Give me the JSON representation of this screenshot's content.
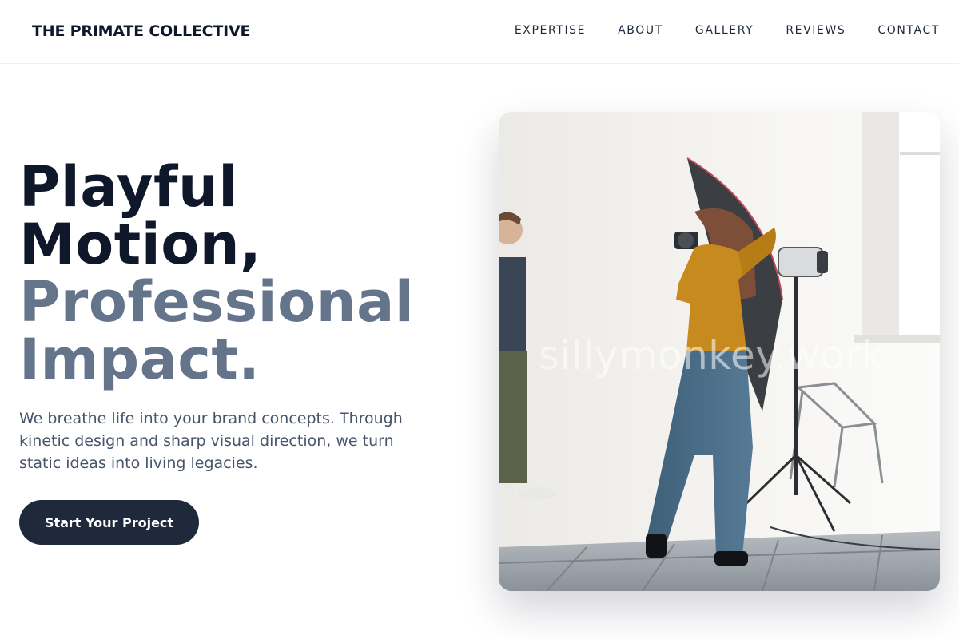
{
  "header": {
    "brand": "THE PRIMATE COLLECTIVE",
    "nav": [
      "EXPERTISE",
      "ABOUT",
      "GALLERY",
      "REVIEWS",
      "CONTACT"
    ]
  },
  "hero": {
    "title_line1": "Playful",
    "title_line2": "Motion,",
    "title_line3": "Professional",
    "title_line4": "Impact.",
    "description": "We breathe life into your brand concepts. Through kinetic design and sharp visual direction, we turn static ideas into living legacies.",
    "cta_label": "Start Your Project",
    "watermark": "sillymonkey.work"
  },
  "colors": {
    "ink": "#0f172a",
    "slate": "#64748b",
    "button": "#1e293b"
  }
}
